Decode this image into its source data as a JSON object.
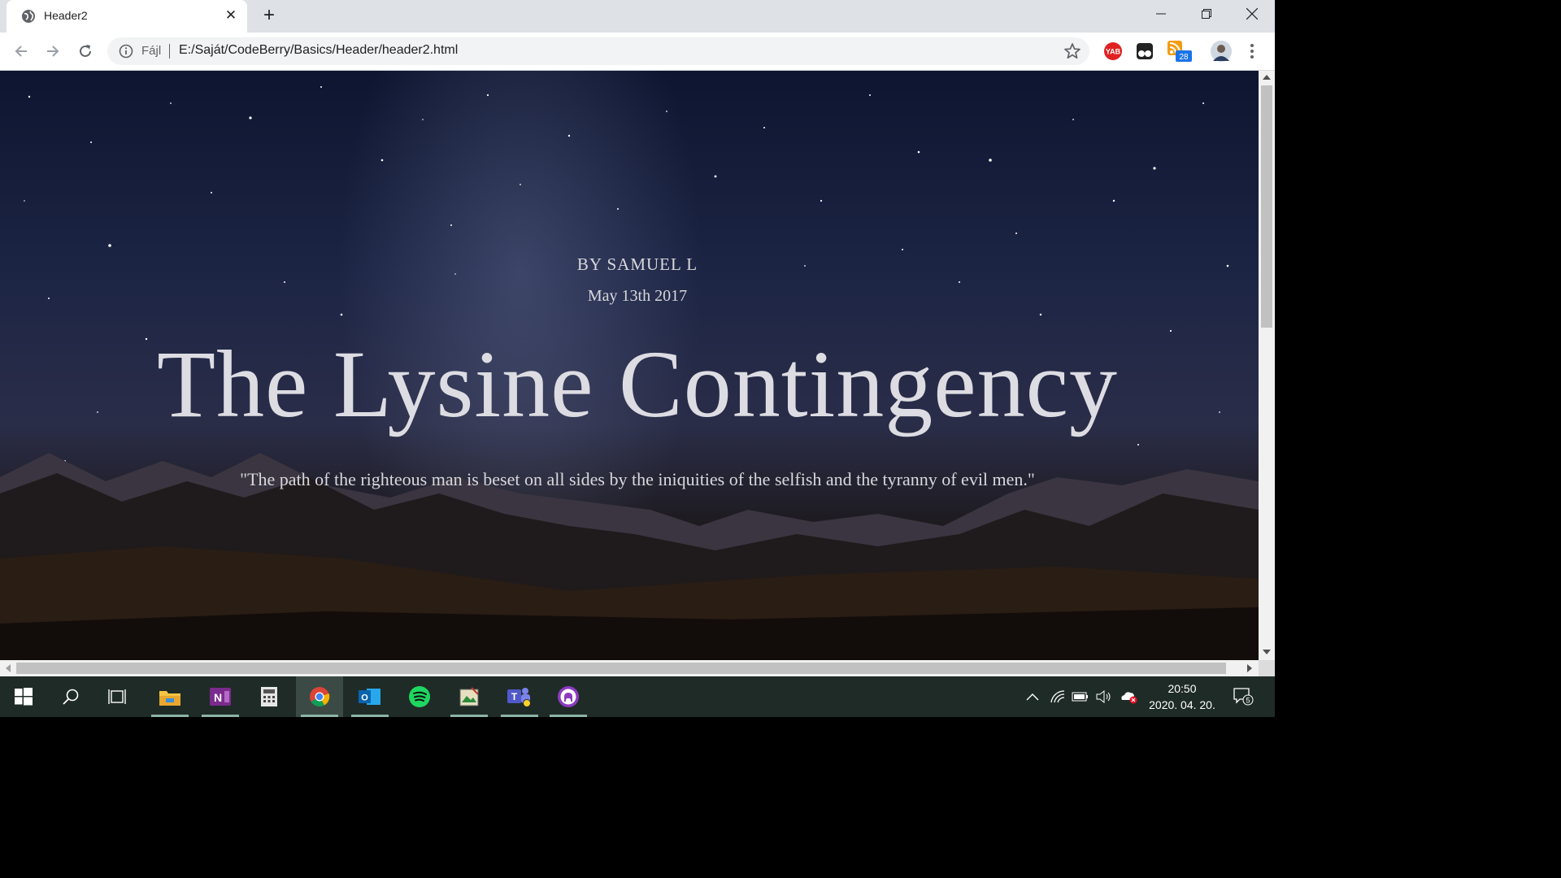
{
  "browser": {
    "tab_title": "Header2",
    "url_scheme_label": "Fájl",
    "url": "E:/Saját/CodeBerry/Basics/Header/header2.html",
    "extensions": {
      "yab_label": "YAB",
      "feed_badge": "28"
    }
  },
  "page": {
    "author": "BY SAMUEL L",
    "date": "May 13th 2017",
    "headline": "The Lysine Contingency",
    "quote": "\"The path of the righteous man is beset on all sides by the iniquities of the selfish and the tyranny of evil men.\""
  },
  "taskbar": {
    "apps": [
      "start-icon",
      "search-icon",
      "task-view-icon",
      "file-explorer-icon",
      "onenote-icon",
      "calculator-icon",
      "chrome-icon",
      "outlook-icon",
      "spotify-icon",
      "sketch-app-icon",
      "teams-icon",
      "github-icon"
    ],
    "time": "20:50",
    "date": "2020. 04. 20.",
    "notification_count": "5"
  },
  "colors": {
    "tab_strip": "#dee1e6",
    "taskbar": "#1f2b27",
    "headline_text": "#dcdce2"
  }
}
